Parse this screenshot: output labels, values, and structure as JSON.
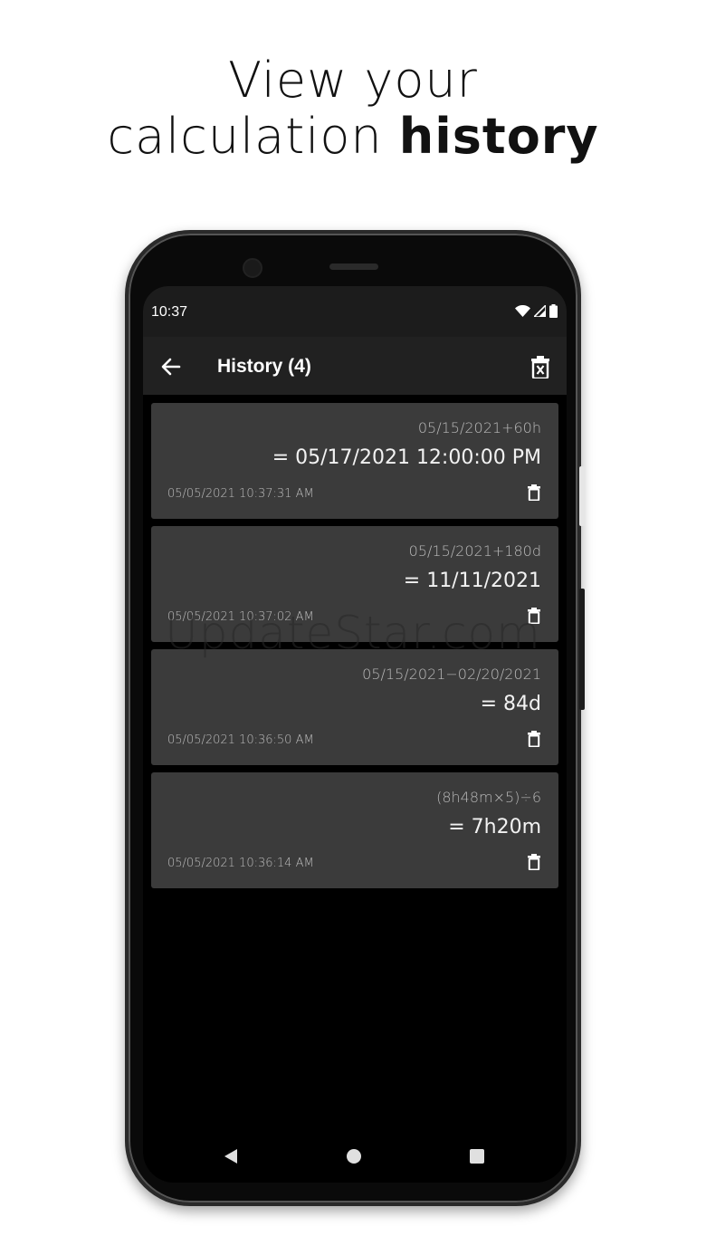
{
  "headline": {
    "line1": "View your",
    "line2_regular": "calculation ",
    "line2_bold": "history"
  },
  "status": {
    "time": "10:37"
  },
  "appbar": {
    "title": "History (4)"
  },
  "history": [
    {
      "expression": "05/15/2021+60h",
      "result": "= 05/17/2021 12:00:00 PM",
      "timestamp": "05/05/2021 10:37:31 AM"
    },
    {
      "expression": "05/15/2021+180d",
      "result": "= 11/11/2021",
      "timestamp": "05/05/2021 10:37:02 AM"
    },
    {
      "expression": "05/15/2021−02/20/2021",
      "result": "= 84d",
      "timestamp": "05/05/2021 10:36:50 AM"
    },
    {
      "expression": "(8h48m×5)÷6",
      "result": "= 7h20m",
      "timestamp": "05/05/2021 10:36:14 AM"
    }
  ],
  "watermark": "UpdateStar.com",
  "icons": {
    "back": "arrow-left-icon",
    "clear": "trash-x-icon",
    "delete": "trash-icon",
    "wifi": "wifi-icon",
    "signal": "signal-icon",
    "battery": "battery-icon"
  },
  "colors": {
    "background": "#ffffff",
    "screen": "#000000",
    "card": "#3b3b3b",
    "appbar": "#212121"
  }
}
